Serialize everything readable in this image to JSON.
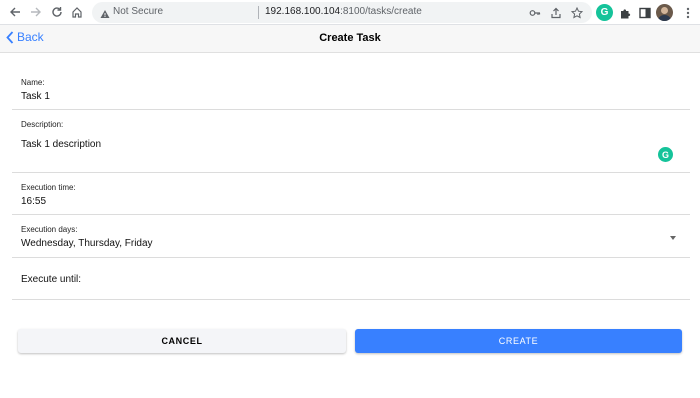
{
  "browser": {
    "security_label": "Not Secure",
    "url_host": "192.168.100.104",
    "url_path": ":8100/tasks/create",
    "extension_letter": "G"
  },
  "header": {
    "back_label": "Back",
    "title": "Create Task"
  },
  "form": {
    "name": {
      "label": "Name:",
      "value": "Task 1"
    },
    "description": {
      "label": "Description:",
      "value": "Task 1 description",
      "grammarly_letter": "G"
    },
    "execution_time": {
      "label": "Execution time:",
      "value": "16:55"
    },
    "execution_days": {
      "label": "Execution days:",
      "value": "Wednesday, Thursday, Friday"
    },
    "execute_until": {
      "label": "Execute until:"
    }
  },
  "actions": {
    "cancel_label": "CANCEL",
    "create_label": "CREATE"
  },
  "colors": {
    "accent": "#3880ff",
    "grammarly": "#15c39a"
  }
}
